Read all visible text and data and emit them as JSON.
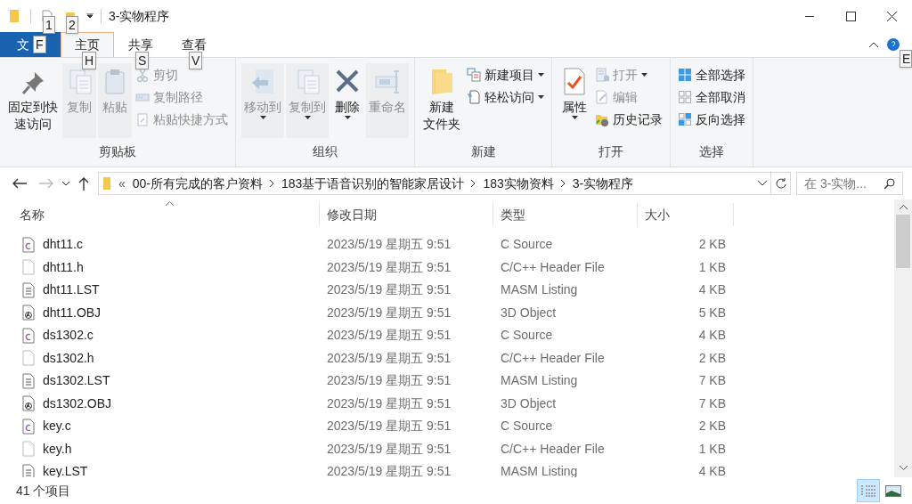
{
  "window": {
    "title": "3-实物程序"
  },
  "quick_access_keytips": [
    "1",
    "2"
  ],
  "tabs": [
    {
      "label": "文",
      "kind": "file",
      "keytip": "F",
      "selected": false
    },
    {
      "label": "主页",
      "kind": "tab",
      "keytip": "H",
      "selected": true
    },
    {
      "label": "共享",
      "kind": "tab",
      "keytip": "S",
      "selected": false
    },
    {
      "label": "查看",
      "kind": "tab",
      "keytip": "V",
      "selected": false
    }
  ],
  "help_keytip": "E",
  "ribbon": [
    {
      "label": "剪贴板",
      "large": [
        {
          "lines": [
            "固定到快",
            "速访问"
          ],
          "disabled": false,
          "dropdown": false
        },
        {
          "lines": [
            "复制"
          ],
          "disabled": true,
          "dropdown": false
        },
        {
          "lines": [
            "粘贴"
          ],
          "disabled": true,
          "dropdown": false
        }
      ],
      "small": [
        {
          "label": "剪切",
          "disabled": true,
          "dropdown": false
        },
        {
          "label": "复制路径",
          "disabled": true,
          "dropdown": false
        },
        {
          "label": "粘贴快捷方式",
          "disabled": true,
          "dropdown": false
        }
      ]
    },
    {
      "label": "组织",
      "large": [
        {
          "lines": [
            "移动到"
          ],
          "disabled": true,
          "dropdown": true
        },
        {
          "lines": [
            "复制到"
          ],
          "disabled": true,
          "dropdown": true
        },
        {
          "lines": [
            "删除"
          ],
          "disabled": false,
          "dropdown": true
        },
        {
          "lines": [
            "重命名"
          ],
          "disabled": true,
          "dropdown": false
        }
      ]
    },
    {
      "label": "新建",
      "large": [
        {
          "lines": [
            "新建",
            "文件夹"
          ],
          "disabled": false,
          "dropdown": false
        }
      ],
      "small": [
        {
          "label": "新建项目",
          "disabled": false,
          "dropdown": true
        },
        {
          "label": "轻松访问",
          "disabled": false,
          "dropdown": true
        }
      ]
    },
    {
      "label": "打开",
      "large": [
        {
          "lines": [
            "属性"
          ],
          "disabled": false,
          "dropdown": true
        }
      ],
      "small": [
        {
          "label": "打开",
          "disabled": true,
          "dropdown": true
        },
        {
          "label": "编辑",
          "disabled": true,
          "dropdown": false
        },
        {
          "label": "历史记录",
          "disabled": false,
          "dropdown": false
        }
      ]
    },
    {
      "label": "选择",
      "small": [
        {
          "label": "全部选择",
          "disabled": false,
          "dropdown": false
        },
        {
          "label": "全部取消",
          "disabled": false,
          "dropdown": false
        },
        {
          "label": "反向选择",
          "disabled": false,
          "dropdown": false
        }
      ]
    }
  ],
  "address": {
    "overflow": "«",
    "path": [
      "00-所有完成的客户资料",
      "183基于语音识别的智能家居设计",
      "183实物资料",
      "3-实物程序"
    ],
    "search_placeholder": "在 3-实物..."
  },
  "table": {
    "columns": [
      "名称",
      "修改日期",
      "类型",
      "大小"
    ],
    "rows": [
      {
        "kind": "c",
        "name": "dht11.c",
        "date": "2023/5/19 星期五 9:51",
        "type": "C Source",
        "size": "2 KB"
      },
      {
        "kind": "h",
        "name": "dht11.h",
        "date": "2023/5/19 星期五 9:51",
        "type": "C/C++ Header File",
        "size": "1 KB"
      },
      {
        "kind": "lst",
        "name": "dht11.LST",
        "date": "2023/5/19 星期五 9:51",
        "type": "MASM Listing",
        "size": "4 KB"
      },
      {
        "kind": "obj",
        "name": "dht11.OBJ",
        "date": "2023/5/19 星期五 9:51",
        "type": "3D Object",
        "size": "5 KB"
      },
      {
        "kind": "c",
        "name": "ds1302.c",
        "date": "2023/5/19 星期五 9:51",
        "type": "C Source",
        "size": "4 KB"
      },
      {
        "kind": "h",
        "name": "ds1302.h",
        "date": "2023/5/19 星期五 9:51",
        "type": "C/C++ Header File",
        "size": "2 KB"
      },
      {
        "kind": "lst",
        "name": "ds1302.LST",
        "date": "2023/5/19 星期五 9:51",
        "type": "MASM Listing",
        "size": "7 KB"
      },
      {
        "kind": "obj",
        "name": "ds1302.OBJ",
        "date": "2023/5/19 星期五 9:51",
        "type": "3D Object",
        "size": "7 KB"
      },
      {
        "kind": "c",
        "name": "key.c",
        "date": "2023/5/19 星期五 9:51",
        "type": "C Source",
        "size": "2 KB"
      },
      {
        "kind": "h",
        "name": "key.h",
        "date": "2023/5/19 星期五 9:51",
        "type": "C/C++ Header File",
        "size": "1 KB"
      },
      {
        "kind": "lst",
        "name": "key.LST",
        "date": "2023/5/19 星期五 9:51",
        "type": "MASM Listing",
        "size": "4 KB"
      }
    ]
  },
  "status_bar": {
    "count": "41 个项目",
    "views": [
      {
        "kind": "details",
        "selected": true
      },
      {
        "kind": "thumbs",
        "selected": false
      }
    ]
  }
}
